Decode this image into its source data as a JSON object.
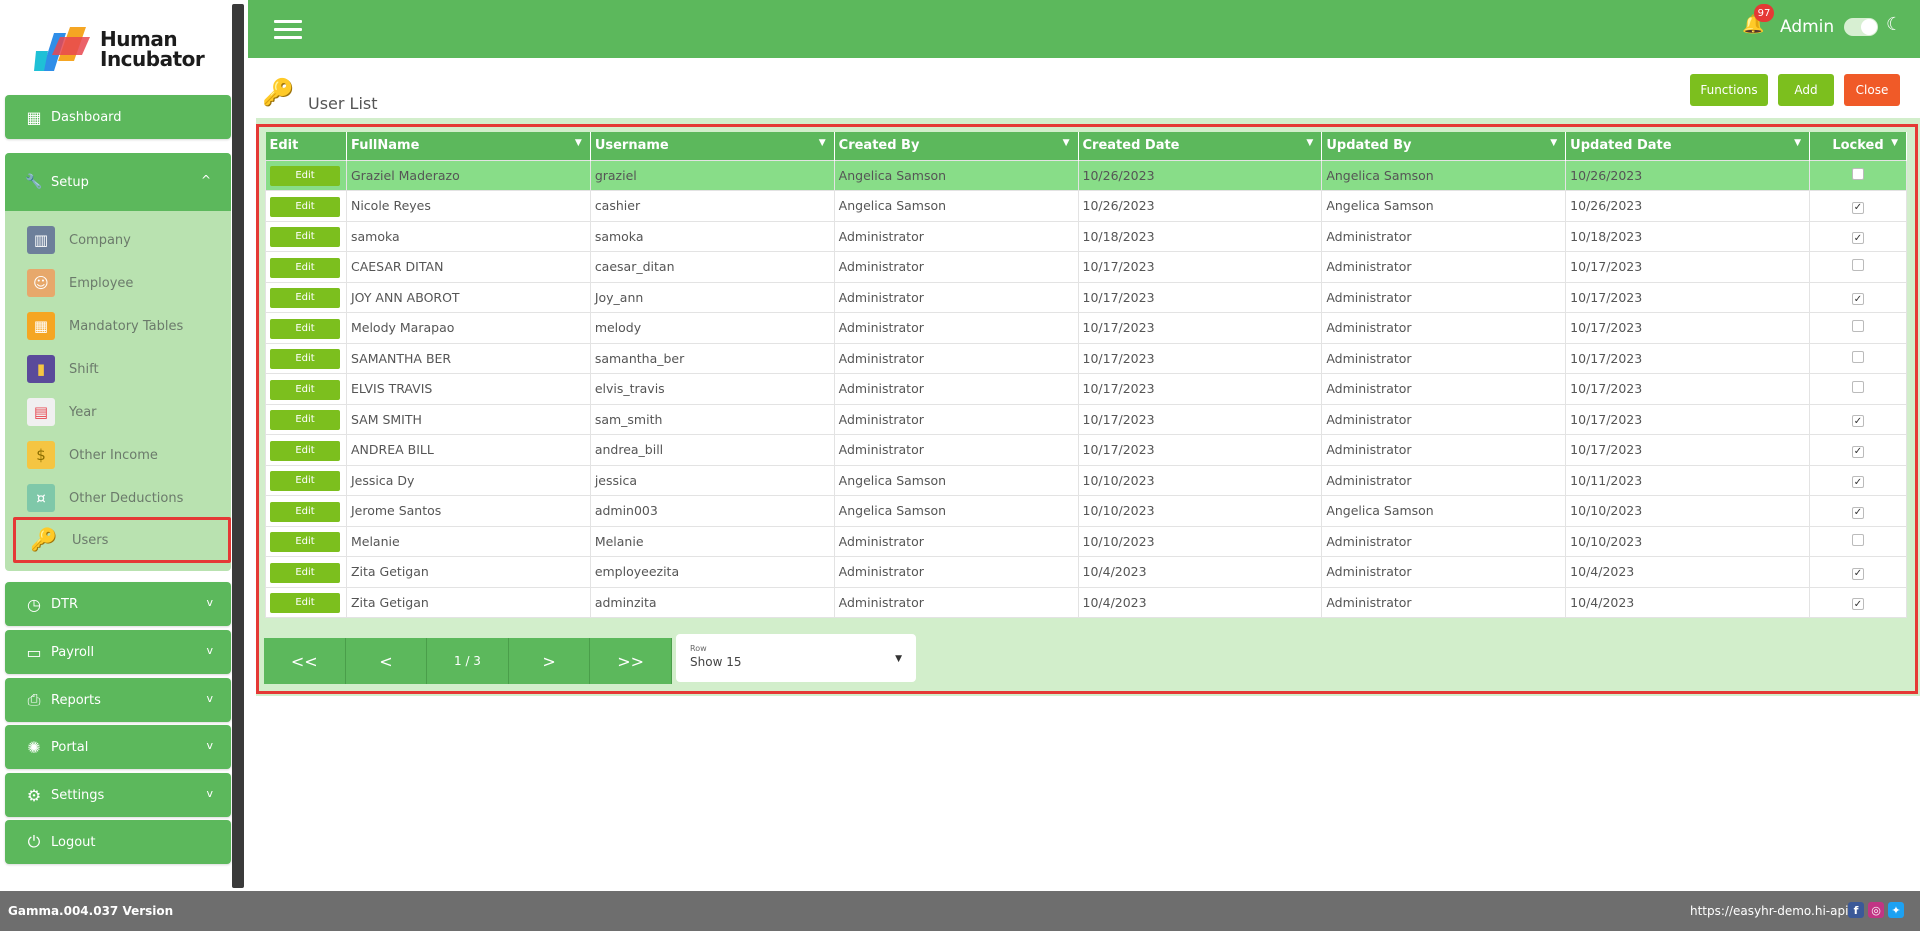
{
  "brand": {
    "line1": "Human",
    "line2": "Incubator"
  },
  "nav": {
    "dashboard": "Dashboard",
    "setup": "Setup",
    "setup_items": [
      "Company",
      "Employee",
      "Mandatory Tables",
      "Shift",
      "Year",
      "Other Income",
      "Other Deductions",
      "Users"
    ],
    "dtr": "DTR",
    "payroll": "Payroll",
    "reports": "Reports",
    "portal": "Portal",
    "settings": "Settings",
    "logout": "Logout"
  },
  "topbar": {
    "notification_count": "97",
    "user": "Admin"
  },
  "page": {
    "title": "User List"
  },
  "actions": {
    "functions": "Functions",
    "add": "Add",
    "close": "Close"
  },
  "table": {
    "columns": [
      "Edit",
      "FullName",
      "Username",
      "Created By",
      "Created Date",
      "Updated By",
      "Updated Date",
      "Locked"
    ],
    "edit_label": "Edit",
    "rows": [
      {
        "fullname": "Graziel Maderazo",
        "username": "graziel",
        "created_by": "Angelica Samson",
        "created_date": "10/26/2023",
        "updated_by": "Angelica Samson",
        "updated_date": "10/26/2023",
        "locked": false
      },
      {
        "fullname": "Nicole Reyes",
        "username": "cashier",
        "created_by": "Angelica Samson",
        "created_date": "10/26/2023",
        "updated_by": "Angelica Samson",
        "updated_date": "10/26/2023",
        "locked": true
      },
      {
        "fullname": "samoka",
        "username": "samoka",
        "created_by": "Administrator",
        "created_date": "10/18/2023",
        "updated_by": "Administrator",
        "updated_date": "10/18/2023",
        "locked": true
      },
      {
        "fullname": "CAESAR DITAN",
        "username": "caesar_ditan",
        "created_by": "Administrator",
        "created_date": "10/17/2023",
        "updated_by": "Administrator",
        "updated_date": "10/17/2023",
        "locked": false
      },
      {
        "fullname": "JOY ANN ABOROT",
        "username": "Joy_ann",
        "created_by": "Administrator",
        "created_date": "10/17/2023",
        "updated_by": "Administrator",
        "updated_date": "10/17/2023",
        "locked": true
      },
      {
        "fullname": "Melody Marapao",
        "username": "melody",
        "created_by": "Administrator",
        "created_date": "10/17/2023",
        "updated_by": "Administrator",
        "updated_date": "10/17/2023",
        "locked": false
      },
      {
        "fullname": "SAMANTHA BER",
        "username": "samantha_ber",
        "created_by": "Administrator",
        "created_date": "10/17/2023",
        "updated_by": "Administrator",
        "updated_date": "10/17/2023",
        "locked": false
      },
      {
        "fullname": "ELVIS TRAVIS",
        "username": "elvis_travis",
        "created_by": "Administrator",
        "created_date": "10/17/2023",
        "updated_by": "Administrator",
        "updated_date": "10/17/2023",
        "locked": false
      },
      {
        "fullname": "SAM SMITH",
        "username": "sam_smith",
        "created_by": "Administrator",
        "created_date": "10/17/2023",
        "updated_by": "Administrator",
        "updated_date": "10/17/2023",
        "locked": true
      },
      {
        "fullname": "ANDREA BILL",
        "username": "andrea_bill",
        "created_by": "Administrator",
        "created_date": "10/17/2023",
        "updated_by": "Administrator",
        "updated_date": "10/17/2023",
        "locked": true
      },
      {
        "fullname": "Jessica Dy",
        "username": "jessica",
        "created_by": "Angelica Samson",
        "created_date": "10/10/2023",
        "updated_by": "Administrator",
        "updated_date": "10/11/2023",
        "locked": true
      },
      {
        "fullname": "Jerome Santos",
        "username": "admin003",
        "created_by": "Angelica Samson",
        "created_date": "10/10/2023",
        "updated_by": "Angelica Samson",
        "updated_date": "10/10/2023",
        "locked": true
      },
      {
        "fullname": "Melanie",
        "username": "Melanie",
        "created_by": "Administrator",
        "created_date": "10/10/2023",
        "updated_by": "Administrator",
        "updated_date": "10/10/2023",
        "locked": false
      },
      {
        "fullname": "Zita Getigan",
        "username": "employeezita",
        "created_by": "Administrator",
        "created_date": "10/4/2023",
        "updated_by": "Administrator",
        "updated_date": "10/4/2023",
        "locked": true
      },
      {
        "fullname": "Zita Getigan",
        "username": "adminzita",
        "created_by": "Administrator",
        "created_date": "10/4/2023",
        "updated_by": "Administrator",
        "updated_date": "10/4/2023",
        "locked": true
      }
    ]
  },
  "pager": {
    "first": "<<",
    "prev": "<",
    "page": "1 / 3",
    "next": ">",
    "last": ">>",
    "rows_label": "Row",
    "rows_value": "Show 15"
  },
  "footer": {
    "version": "Gamma.004.037 Version",
    "site": "https://easyhr-demo.hi-api.io"
  },
  "colors": {
    "primary": "#5cb85c",
    "accent": "#7cbf1e",
    "danger": "#f05a28",
    "highlight": "#e53935",
    "panel": "#b9e2b0"
  }
}
